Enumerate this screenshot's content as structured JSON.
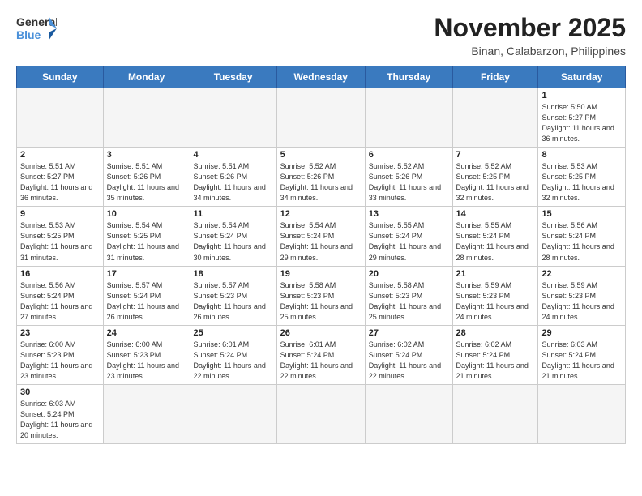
{
  "logo": {
    "general": "General",
    "blue": "Blue"
  },
  "title": "November 2025",
  "subtitle": "Binan, Calabarzon, Philippines",
  "headers": [
    "Sunday",
    "Monday",
    "Tuesday",
    "Wednesday",
    "Thursday",
    "Friday",
    "Saturday"
  ],
  "weeks": [
    [
      {
        "day": "",
        "info": ""
      },
      {
        "day": "",
        "info": ""
      },
      {
        "day": "",
        "info": ""
      },
      {
        "day": "",
        "info": ""
      },
      {
        "day": "",
        "info": ""
      },
      {
        "day": "",
        "info": ""
      },
      {
        "day": "1",
        "info": "Sunrise: 5:50 AM\nSunset: 5:27 PM\nDaylight: 11 hours and 36 minutes."
      }
    ],
    [
      {
        "day": "2",
        "info": "Sunrise: 5:51 AM\nSunset: 5:27 PM\nDaylight: 11 hours and 36 minutes."
      },
      {
        "day": "3",
        "info": "Sunrise: 5:51 AM\nSunset: 5:26 PM\nDaylight: 11 hours and 35 minutes."
      },
      {
        "day": "4",
        "info": "Sunrise: 5:51 AM\nSunset: 5:26 PM\nDaylight: 11 hours and 34 minutes."
      },
      {
        "day": "5",
        "info": "Sunrise: 5:52 AM\nSunset: 5:26 PM\nDaylight: 11 hours and 34 minutes."
      },
      {
        "day": "6",
        "info": "Sunrise: 5:52 AM\nSunset: 5:26 PM\nDaylight: 11 hours and 33 minutes."
      },
      {
        "day": "7",
        "info": "Sunrise: 5:52 AM\nSunset: 5:25 PM\nDaylight: 11 hours and 32 minutes."
      },
      {
        "day": "8",
        "info": "Sunrise: 5:53 AM\nSunset: 5:25 PM\nDaylight: 11 hours and 32 minutes."
      }
    ],
    [
      {
        "day": "9",
        "info": "Sunrise: 5:53 AM\nSunset: 5:25 PM\nDaylight: 11 hours and 31 minutes."
      },
      {
        "day": "10",
        "info": "Sunrise: 5:54 AM\nSunset: 5:25 PM\nDaylight: 11 hours and 31 minutes."
      },
      {
        "day": "11",
        "info": "Sunrise: 5:54 AM\nSunset: 5:24 PM\nDaylight: 11 hours and 30 minutes."
      },
      {
        "day": "12",
        "info": "Sunrise: 5:54 AM\nSunset: 5:24 PM\nDaylight: 11 hours and 29 minutes."
      },
      {
        "day": "13",
        "info": "Sunrise: 5:55 AM\nSunset: 5:24 PM\nDaylight: 11 hours and 29 minutes."
      },
      {
        "day": "14",
        "info": "Sunrise: 5:55 AM\nSunset: 5:24 PM\nDaylight: 11 hours and 28 minutes."
      },
      {
        "day": "15",
        "info": "Sunrise: 5:56 AM\nSunset: 5:24 PM\nDaylight: 11 hours and 28 minutes."
      }
    ],
    [
      {
        "day": "16",
        "info": "Sunrise: 5:56 AM\nSunset: 5:24 PM\nDaylight: 11 hours and 27 minutes."
      },
      {
        "day": "17",
        "info": "Sunrise: 5:57 AM\nSunset: 5:24 PM\nDaylight: 11 hours and 26 minutes."
      },
      {
        "day": "18",
        "info": "Sunrise: 5:57 AM\nSunset: 5:23 PM\nDaylight: 11 hours and 26 minutes."
      },
      {
        "day": "19",
        "info": "Sunrise: 5:58 AM\nSunset: 5:23 PM\nDaylight: 11 hours and 25 minutes."
      },
      {
        "day": "20",
        "info": "Sunrise: 5:58 AM\nSunset: 5:23 PM\nDaylight: 11 hours and 25 minutes."
      },
      {
        "day": "21",
        "info": "Sunrise: 5:59 AM\nSunset: 5:23 PM\nDaylight: 11 hours and 24 minutes."
      },
      {
        "day": "22",
        "info": "Sunrise: 5:59 AM\nSunset: 5:23 PM\nDaylight: 11 hours and 24 minutes."
      }
    ],
    [
      {
        "day": "23",
        "info": "Sunrise: 6:00 AM\nSunset: 5:23 PM\nDaylight: 11 hours and 23 minutes."
      },
      {
        "day": "24",
        "info": "Sunrise: 6:00 AM\nSunset: 5:23 PM\nDaylight: 11 hours and 23 minutes."
      },
      {
        "day": "25",
        "info": "Sunrise: 6:01 AM\nSunset: 5:24 PM\nDaylight: 11 hours and 22 minutes."
      },
      {
        "day": "26",
        "info": "Sunrise: 6:01 AM\nSunset: 5:24 PM\nDaylight: 11 hours and 22 minutes."
      },
      {
        "day": "27",
        "info": "Sunrise: 6:02 AM\nSunset: 5:24 PM\nDaylight: 11 hours and 22 minutes."
      },
      {
        "day": "28",
        "info": "Sunrise: 6:02 AM\nSunset: 5:24 PM\nDaylight: 11 hours and 21 minutes."
      },
      {
        "day": "29",
        "info": "Sunrise: 6:03 AM\nSunset: 5:24 PM\nDaylight: 11 hours and 21 minutes."
      }
    ],
    [
      {
        "day": "30",
        "info": "Sunrise: 6:03 AM\nSunset: 5:24 PM\nDaylight: 11 hours and 20 minutes."
      },
      {
        "day": "",
        "info": ""
      },
      {
        "day": "",
        "info": ""
      },
      {
        "day": "",
        "info": ""
      },
      {
        "day": "",
        "info": ""
      },
      {
        "day": "",
        "info": ""
      },
      {
        "day": "",
        "info": ""
      }
    ]
  ]
}
